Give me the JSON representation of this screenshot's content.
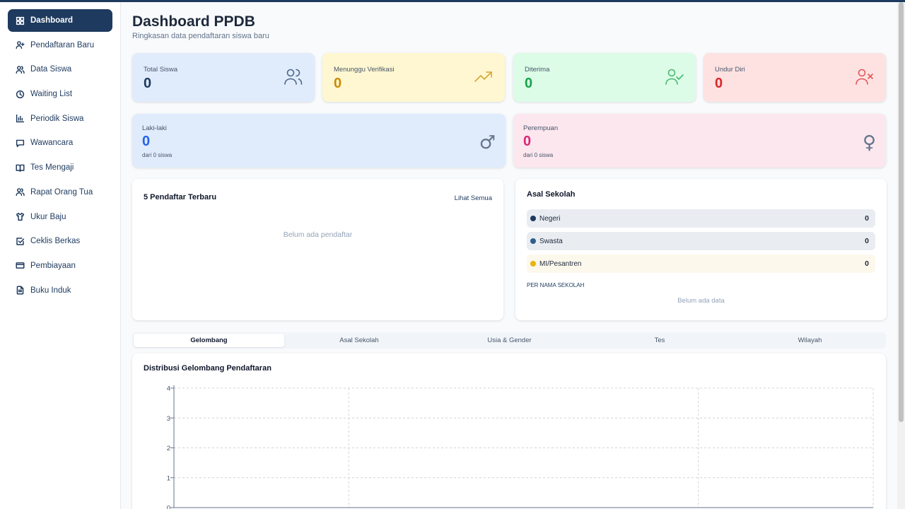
{
  "sidebar": {
    "items": [
      {
        "label": "Dashboard",
        "icon": "grid-icon",
        "active": true
      },
      {
        "label": "Pendaftaran Baru",
        "icon": "user-plus-icon"
      },
      {
        "label": "Data Siswa",
        "icon": "users-icon"
      },
      {
        "label": "Waiting List",
        "icon": "clock-icon"
      },
      {
        "label": "Periodik Siswa",
        "icon": "bar-chart-icon"
      },
      {
        "label": "Wawancara",
        "icon": "message-icon"
      },
      {
        "label": "Tes Mengaji",
        "icon": "book-open-icon"
      },
      {
        "label": "Rapat Orang Tua",
        "icon": "users-icon"
      },
      {
        "label": "Ukur Baju",
        "icon": "shirt-icon"
      },
      {
        "label": "Ceklis Berkas",
        "icon": "checkbox-icon"
      },
      {
        "label": "Pembiayaan",
        "icon": "credit-card-icon"
      },
      {
        "label": "Buku Induk",
        "icon": "file-text-icon"
      }
    ]
  },
  "header": {
    "title": "Dashboard PPDB",
    "subtitle": "Ringkasan data pendaftaran siswa baru"
  },
  "stats": [
    {
      "label": "Total Siswa",
      "value": "0",
      "icon": "users-icon",
      "bg": "#e0ecfc",
      "color": "#1e3a5f"
    },
    {
      "label": "Menunggu Verifikasi",
      "value": "0",
      "icon": "trending-up-icon",
      "bg": "#fef7d1",
      "color": "#ca8a04"
    },
    {
      "label": "Diterima",
      "value": "0",
      "icon": "user-check-icon",
      "bg": "#dcfce7",
      "color": "#16a34a"
    },
    {
      "label": "Undur Diri",
      "value": "0",
      "icon": "user-x-icon",
      "bg": "#fee2e2",
      "color": "#dc2626"
    }
  ],
  "gender": {
    "male": {
      "label": "Laki-laki",
      "value": "0",
      "sub": "dari 0 siswa",
      "symbol": "♂",
      "color": "#2563eb"
    },
    "female": {
      "label": "Perempuan",
      "value": "0",
      "sub": "dari 0 siswa",
      "symbol": "♀",
      "color": "#db2777"
    }
  },
  "recent": {
    "title": "5 Pendaftar Terbaru",
    "link": "Lihat Semua",
    "empty": "Belum ada pendaftar"
  },
  "school_origin": {
    "title": "Asal Sekolah",
    "rows": [
      {
        "label": "Negeri",
        "count": "0",
        "dot": "#1e3a5f",
        "bg": "#e9edf2"
      },
      {
        "label": "Swasta",
        "count": "0",
        "dot": "#2f5f8f",
        "bg": "#e9edf2"
      },
      {
        "label": "MI/Pesantren",
        "count": "0",
        "dot": "#eab308",
        "bg": "#fdf8ec"
      }
    ],
    "per_name_label": "PER NAMA SEKOLAH",
    "empty": "Belum ada data"
  },
  "tabs": [
    "Gelombang",
    "Asal Sekolah",
    "Usia & Gender",
    "Tes",
    "Wilayah"
  ],
  "active_tab": 0,
  "chart_title": "Distribusi Gelombang Pendaftaran",
  "chart_data": {
    "type": "bar",
    "categories": [],
    "values": [],
    "title": "Distribusi Gelombang Pendaftaran",
    "xlabel": "",
    "ylabel": "",
    "ylim": [
      0,
      4
    ],
    "yticks": [
      "0",
      "1",
      "2",
      "3",
      "4"
    ],
    "grid": true
  }
}
